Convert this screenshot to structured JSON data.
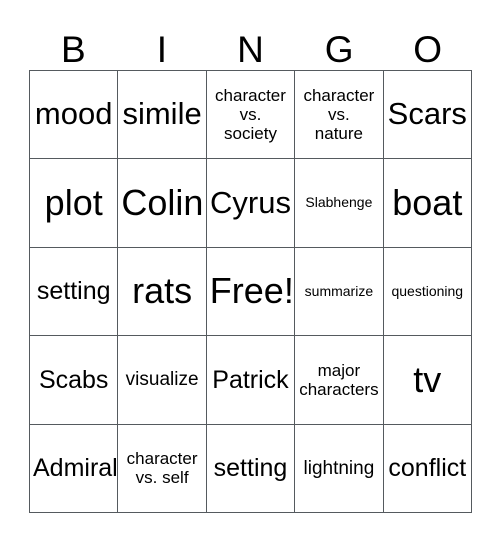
{
  "card": {
    "title_letters": [
      "B",
      "I",
      "N",
      "G",
      "O"
    ],
    "rows": [
      [
        {
          "text": "mood",
          "size": "lg"
        },
        {
          "text": "simile",
          "size": "lg"
        },
        {
          "text": "character\nvs.\nsociety",
          "size": "xs"
        },
        {
          "text": "character\nvs.\nnature",
          "size": "xs"
        },
        {
          "text": "Scars",
          "size": "lg"
        }
      ],
      [
        {
          "text": "plot",
          "size": "xl"
        },
        {
          "text": "Colin",
          "size": "xl"
        },
        {
          "text": "Cyrus",
          "size": "lg"
        },
        {
          "text": "Slabhenge",
          "size": "xxs"
        },
        {
          "text": "boat",
          "size": "xl"
        }
      ],
      [
        {
          "text": "setting",
          "size": "md"
        },
        {
          "text": "rats",
          "size": "xl"
        },
        {
          "text": "Free!",
          "size": "xl"
        },
        {
          "text": "summarize",
          "size": "xxs"
        },
        {
          "text": "questioning",
          "size": "xxs"
        }
      ],
      [
        {
          "text": "Scabs",
          "size": "md"
        },
        {
          "text": "visualize",
          "size": "sm"
        },
        {
          "text": "Patrick",
          "size": "md"
        },
        {
          "text": "major\ncharacters",
          "size": "xs"
        },
        {
          "text": "tv",
          "size": "xl"
        }
      ],
      [
        {
          "text": "Admiral",
          "size": "md"
        },
        {
          "text": "character\nvs. self",
          "size": "xs"
        },
        {
          "text": "setting",
          "size": "md"
        },
        {
          "text": "lightning",
          "size": "sm"
        },
        {
          "text": "conflict",
          "size": "md"
        }
      ]
    ],
    "colors": {
      "background": "#ffffff",
      "text": "#000000",
      "grid_line": "#555a5e"
    }
  }
}
